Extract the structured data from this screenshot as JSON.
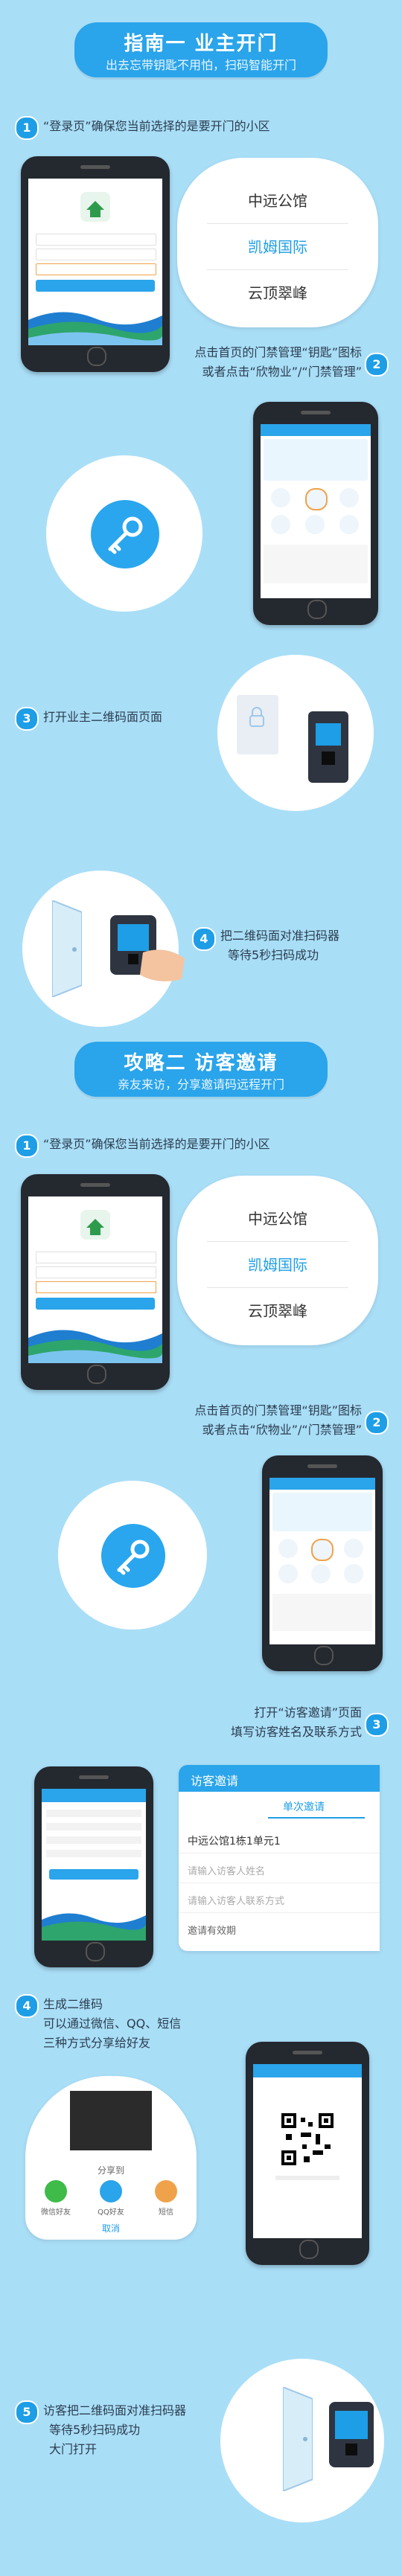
{
  "section1": {
    "title": "指南一  业主开门",
    "subtitle": "出去忘带钥匙不用怕，扫码智能开门"
  },
  "section2": {
    "title": "攻略二  访客邀请",
    "subtitle": "亲友来访，分享邀请码远程开门"
  },
  "s1_steps": [
    {
      "num": "1",
      "text": "“登录页”确保您当前选择的是要开门的小区"
    },
    {
      "num": "2",
      "text1": "点击首页的门禁管理“钥匙”图标",
      "text2": "或者点击“欣物业”/“门禁管理”"
    },
    {
      "num": "3",
      "text": "打开业主二维码面页面"
    },
    {
      "num": "4",
      "text1": "把二维码面对准扫码器",
      "text2": "等待5秒扫码成功"
    }
  ],
  "s2_steps": [
    {
      "num": "1",
      "text": "“登录页”确保您当前选择的是要开门的小区"
    },
    {
      "num": "2",
      "text1": "点击首页的门禁管理“钥匙”图标",
      "text2": "或者点击“欣物业”/“门禁管理”"
    },
    {
      "num": "3",
      "text1": "打开“访客邀请”页面",
      "text2": "填写访客姓名及联系方式"
    },
    {
      "num": "4",
      "text1": "生成二维码",
      "text2": "可以通过微信、QQ、短信",
      "text3": "三种方式分享给好友"
    },
    {
      "num": "5",
      "text1": "访客把二维码面对准扫码器",
      "text2": "等待5秒扫码成功",
      "text3": "大门打开"
    }
  ],
  "communities": [
    "中远公馆",
    "凯姆国际",
    "云顶翠峰"
  ],
  "share_dialog": {
    "title": "分享到",
    "options": [
      "微信好友",
      "QQ好友",
      "短信"
    ],
    "cancel": "取消"
  },
  "visitor_form": {
    "title": "访客邀请",
    "tab": "单次邀请",
    "room": "中远公馆1栋1单元1",
    "name_placeholder": "请输入访客人姓名",
    "phone_placeholder": "请输入访客人联系方式",
    "invite_time": "邀请有效期"
  },
  "colors": {
    "background": "#a9def7",
    "accent": "#1d9ee6",
    "banner": "#2aa4ea"
  }
}
